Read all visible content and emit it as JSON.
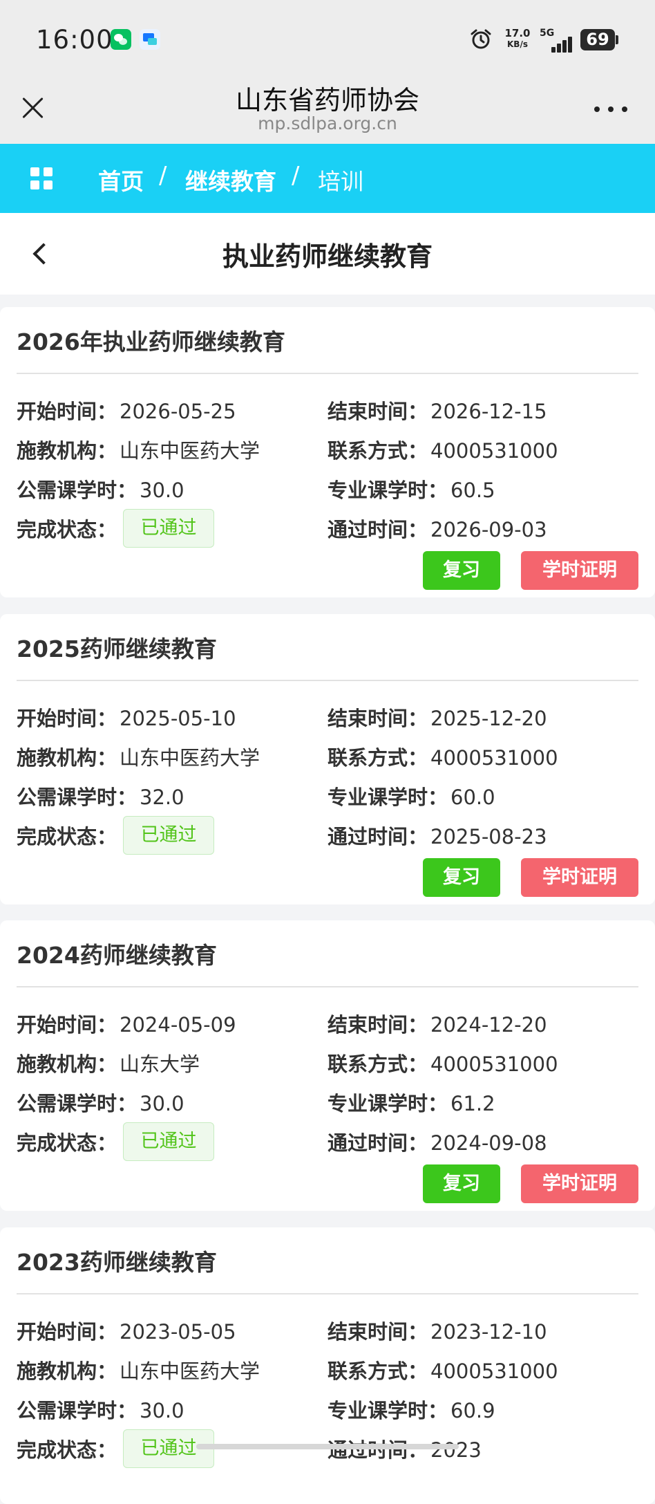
{
  "status_bar": {
    "time": "16:00",
    "net_speed": "17.0",
    "net_unit": "KB/s",
    "network": "5G",
    "battery": "69"
  },
  "title_bar": {
    "title": "山东省药师协会",
    "domain": "mp.sdlpa.org.cn"
  },
  "breadcrumb": {
    "items": [
      "首页",
      "继续教育",
      "培训"
    ],
    "separator": "/"
  },
  "page": {
    "title": "执业药师继续教育"
  },
  "labels": {
    "start": "开始时间：",
    "end": "结束时间：",
    "org": "施教机构：",
    "contact": "联系方式：",
    "public_hours": "公需课学时：",
    "pro_hours": "专业课学时：",
    "status": "完成状态：",
    "pass_time": "通过时间：",
    "review_btn": "复习",
    "cert_btn": "学时证明"
  },
  "records": [
    {
      "title": "2026年执业药师继续教育",
      "start": "2026-05-25",
      "end": "2026-12-15",
      "org": "山东中医药大学",
      "contact": "4000531000",
      "public_hours": "30.0",
      "pro_hours": "60.5",
      "status": "已通过",
      "pass_time": "2026-09-03"
    },
    {
      "title": "2025药师继续教育",
      "start": "2025-05-10",
      "end": "2025-12-20",
      "org": "山东中医药大学",
      "contact": "4000531000",
      "public_hours": "32.0",
      "pro_hours": "60.0",
      "status": "已通过",
      "pass_time": "2025-08-23"
    },
    {
      "title": "2024药师继续教育",
      "start": "2024-05-09",
      "end": "2024-12-20",
      "org": "山东大学",
      "contact": "4000531000",
      "public_hours": "30.0",
      "pro_hours": "61.2",
      "status": "已通过",
      "pass_time": "2024-09-08"
    },
    {
      "title": "2023药师继续教育",
      "start": "2023-05-05",
      "end": "2023-12-10",
      "org": "山东中医药大学",
      "contact": "4000531000",
      "public_hours": "30.0",
      "pro_hours": "60.9",
      "status": "已通过",
      "pass_time": "2023"
    }
  ]
}
